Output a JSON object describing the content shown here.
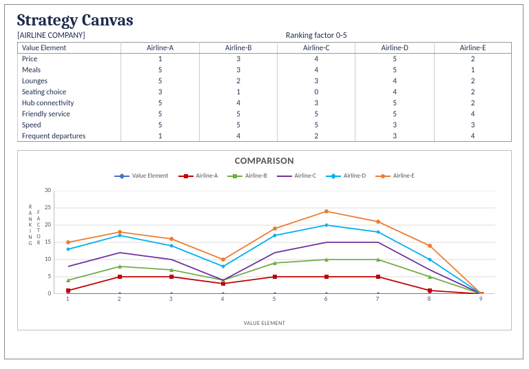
{
  "title": "Strategy Canvas",
  "company_placeholder": "[AIRLINE COMPANY]",
  "ranking_label": "Ranking factor 0-5",
  "table": {
    "headers": [
      "Value Element",
      "Airline-A",
      "Airline-B",
      "Airline-C",
      "Airline-D",
      "Airline-E"
    ],
    "rows": [
      {
        "element": "Price",
        "a": 1,
        "b": 3,
        "c": 4,
        "d": 5,
        "e": 2
      },
      {
        "element": "Meals",
        "a": 5,
        "b": 3,
        "c": 4,
        "d": 5,
        "e": 1
      },
      {
        "element": "Lounges",
        "a": 5,
        "b": 2,
        "c": 3,
        "d": 4,
        "e": 2
      },
      {
        "element": "Seating choice",
        "a": 3,
        "b": 1,
        "c": 0,
        "d": 4,
        "e": 2
      },
      {
        "element": "Hub connectivity",
        "a": 5,
        "b": 4,
        "c": 3,
        "d": 5,
        "e": 2
      },
      {
        "element": "Friendly service",
        "a": 5,
        "b": 5,
        "c": 5,
        "d": 5,
        "e": 4
      },
      {
        "element": "Speed",
        "a": 5,
        "b": 5,
        "c": 5,
        "d": 3,
        "e": 3
      },
      {
        "element": "Frequent departures",
        "a": 1,
        "b": 4,
        "c": 2,
        "d": 3,
        "e": 4
      }
    ]
  },
  "chart": {
    "title": "COMPARISON",
    "xlabel": "VALUE ELEMENT",
    "ylabel_main": "RANKING",
    "ylabel_sub": "FACTOR",
    "legend": [
      "Value Element",
      "Airline-A",
      "Airline-B",
      "Airline-C",
      "Airline-D",
      "Airline-E"
    ]
  },
  "chart_data": {
    "type": "line",
    "title": "COMPARISON",
    "xlabel": "VALUE ELEMENT",
    "ylabel": "RANKING FACTOR",
    "x": [
      1,
      2,
      3,
      4,
      5,
      6,
      7,
      8,
      9
    ],
    "ylim": [
      0,
      30
    ],
    "yticks": [
      0,
      5,
      10,
      15,
      20,
      25,
      30
    ],
    "series": [
      {
        "name": "Value Element",
        "color": "#4472c4",
        "values": [
          0,
          0,
          0,
          0,
          0,
          0,
          0,
          0,
          0
        ]
      },
      {
        "name": "Airline-A",
        "color": "#c00000",
        "values": [
          1,
          5,
          5,
          3,
          5,
          5,
          5,
          1,
          0
        ]
      },
      {
        "name": "Airline-B",
        "color": "#70ad47",
        "values": [
          4,
          8,
          7,
          4,
          9,
          10,
          10,
          5,
          0
        ]
      },
      {
        "name": "Airline-C",
        "color": "#7030a0",
        "values": [
          8,
          12,
          10,
          4,
          12,
          15,
          15,
          7,
          0
        ]
      },
      {
        "name": "Airline-D",
        "color": "#00b0f0",
        "values": [
          13,
          17,
          14,
          8,
          17,
          20,
          18,
          10,
          0
        ]
      },
      {
        "name": "Airline-E",
        "color": "#ed7d31",
        "values": [
          15,
          18,
          16,
          10,
          19,
          24,
          21,
          14,
          0
        ]
      }
    ]
  }
}
